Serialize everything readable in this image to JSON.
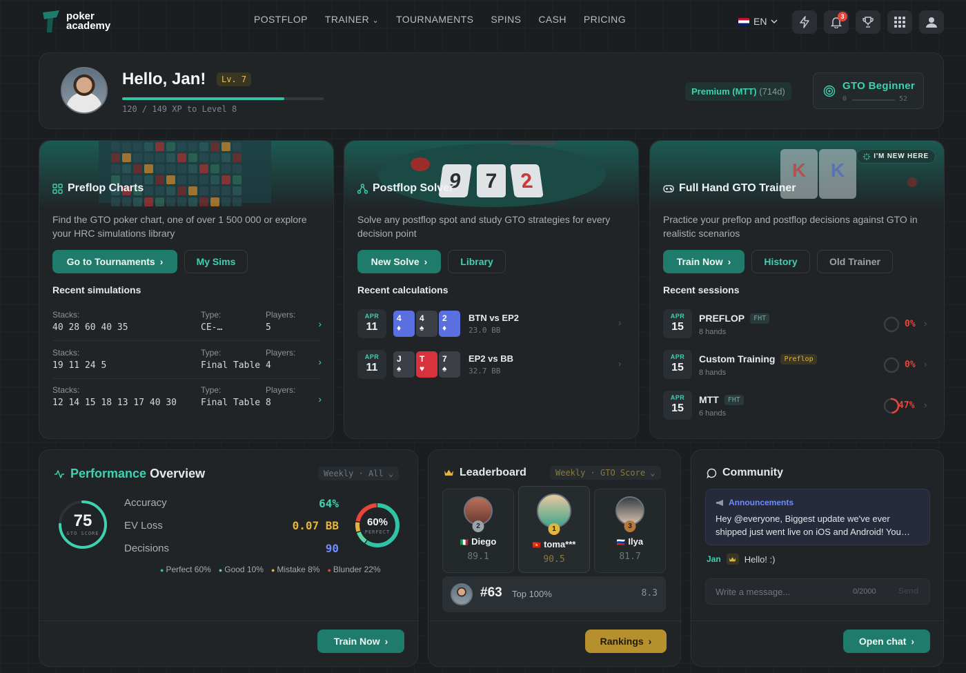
{
  "nav": {
    "logo_line1": "poker",
    "logo_line2": "academy",
    "links": [
      "POSTFLOP",
      "TRAINER",
      "TOURNAMENTS",
      "SPINS",
      "CASH",
      "PRICING"
    ],
    "trainer_caret": "⌄",
    "language": "EN",
    "notification_count": "3"
  },
  "header": {
    "greeting": "Hello, Jan!",
    "level": "Lv. 7",
    "xp_text": "120 / 149 XP to Level 8",
    "xp_progress": 0.805,
    "premium_label": "Premium (MTT)",
    "premium_days": "(714d)",
    "gto_rank": "GTO Beginner",
    "gto_min": "0",
    "gto_max": "52"
  },
  "preflop": {
    "title": "Preflop Charts",
    "description": "Find the GTO poker chart, one of over 1 500 000 or explore your HRC simulations library",
    "primary_btn": "Go to Tournaments",
    "secondary_btn": "My Sims",
    "section": "Recent simulations",
    "stacks_label": "Stacks:",
    "type_label": "Type:",
    "players_label": "Players:",
    "rows": [
      {
        "stacks": "40 28 60 40 35",
        "type": "CE-…",
        "players": "5"
      },
      {
        "stacks": "19 11 24 5",
        "type": "Final Table",
        "players": "4"
      },
      {
        "stacks": "12 14 15 18 13 17 40 30",
        "type": "Final Table",
        "players": "8"
      }
    ]
  },
  "postflop": {
    "title": "Postflop Solver",
    "description": "Solve any postflop spot and study GTO strategies for every decision point",
    "primary_btn": "New Solve",
    "secondary_btn": "Library",
    "section": "Recent calculations",
    "rows": [
      {
        "month": "APR",
        "day": "11",
        "cards": [
          {
            "rank": "4",
            "suit": "♦"
          },
          {
            "rank": "4",
            "suit": "♠"
          },
          {
            "rank": "2",
            "suit": "♦"
          }
        ],
        "name": "BTN vs EP2",
        "sub": "23.0 BB"
      },
      {
        "month": "APR",
        "day": "11",
        "cards": [
          {
            "rank": "J",
            "suit": "♠"
          },
          {
            "rank": "T",
            "suit": "♥"
          },
          {
            "rank": "7",
            "suit": "♠"
          }
        ],
        "name": "EP2 vs BB",
        "sub": "32.7 BB"
      }
    ]
  },
  "trainer": {
    "title": "Full Hand GTO Trainer",
    "badge": "I'M NEW HERE",
    "description": "Practice your preflop and postflop decisions against GTO in realistic scenarios",
    "primary_btn": "Train Now",
    "secondary_btn": "History",
    "tertiary_btn": "Old Trainer",
    "section": "Recent sessions",
    "rows": [
      {
        "month": "APR",
        "day": "15",
        "name": "PREFLOP",
        "tag": "FHT",
        "sub": "8 hands",
        "pct": "0%",
        "progress": 0
      },
      {
        "month": "APR",
        "day": "15",
        "name": "Custom Training",
        "tag": "Preflop",
        "sub": "8 hands",
        "pct": "0%",
        "progress": 0
      },
      {
        "month": "APR",
        "day": "15",
        "name": "MTT",
        "tag": "FHT",
        "sub": "6 hands",
        "pct": "47%",
        "progress": 0.47
      }
    ]
  },
  "performance": {
    "title_accent": "Performance",
    "title_rest": "Overview",
    "filter": "Weekly · All",
    "score": "75",
    "score_label": "GTO SCORE",
    "score_progress": 0.75,
    "metrics": [
      {
        "label": "Accuracy",
        "value": "64%"
      },
      {
        "label": "EV Loss",
        "value": "0.07 BB"
      },
      {
        "label": "Decisions",
        "value": "90"
      }
    ],
    "perfect_pct": "60%",
    "perfect_label": "PERFECT",
    "legend": [
      "Perfect 60%",
      "Good 10%",
      "Mistake 8%",
      "Blunder 22%"
    ],
    "breakdown": [
      0.6,
      0.1,
      0.08,
      0.22
    ],
    "button": "Train Now"
  },
  "leaderboard": {
    "title": "Leaderboard",
    "filter": "Weekly · GTO Score",
    "players": [
      {
        "rank": "2",
        "flag": "🇮🇹",
        "name": "Diego",
        "score": "89.1"
      },
      {
        "rank": "1",
        "flag": "🇻🇳",
        "name": "toma***",
        "score": "90.5"
      },
      {
        "rank": "3",
        "flag": "🇷🇺",
        "name": "Ilya",
        "score": "81.7"
      }
    ],
    "my_rank": "#63",
    "my_top": "Top 100%",
    "my_score": "8.3",
    "button": "Rankings"
  },
  "community": {
    "title": "Community",
    "announcement_title": "Announcements",
    "announcement_text": "Hey @everyone, Biggest update we've ever shipped just went live on iOS and Android! You…",
    "chat_user": "Jan",
    "chat_message": "Hello! :)",
    "input_placeholder": "Write a message...",
    "char_count": "0/2000",
    "send": "Send",
    "button": "Open chat"
  },
  "colors": {
    "accent": "#3fd2b0",
    "primary_btn": "#1f7c6c",
    "gold": "#e3b53c",
    "blue": "#6e8cff",
    "danger": "#e9453b"
  }
}
